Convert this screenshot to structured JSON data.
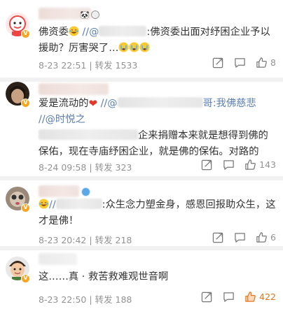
{
  "colors": {
    "link": "#5b7fb2",
    "meta": "#939393",
    "hot_like": "#e8751a",
    "badge": "#f6a623",
    "heart": "#e5382a"
  },
  "reposts": [
    {
      "text_a": "佛资委",
      "text_b": " //@",
      "text_c": ":佛资委出面对纾困企业予以援助？厉害哭了…",
      "time": "8-23 22:51",
      "repost_label": "转发 1533",
      "like_count": "8"
    },
    {
      "text_a": "爱是流动的",
      "text_b": " //@",
      "text_c": "哥:我佛慈悲 //@时悦之",
      "text_d": "企来捐赠本来就是想得到佛的保佑，现在寺庙纾困企业，就是佛的保佑。对路的",
      "time": "8-24 09:58",
      "repost_label": "转发 323",
      "like_count": "143"
    },
    {
      "text_a": "//",
      "text_b": ":众生念力塑金身，感恩回报助众生，这才是佛！",
      "time": "8-23 20:42",
      "repost_label": "转发 218",
      "like_count": "6"
    },
    {
      "text_a": "这……真 · 救苦救难观世音啊",
      "time": "8-23 22:50",
      "repost_label": "转发 188",
      "like_count": "422"
    }
  ],
  "icons": {
    "share": "share-icon",
    "comment": "comment-icon",
    "like": "like-icon",
    "verified": "verified-badge-icon"
  }
}
